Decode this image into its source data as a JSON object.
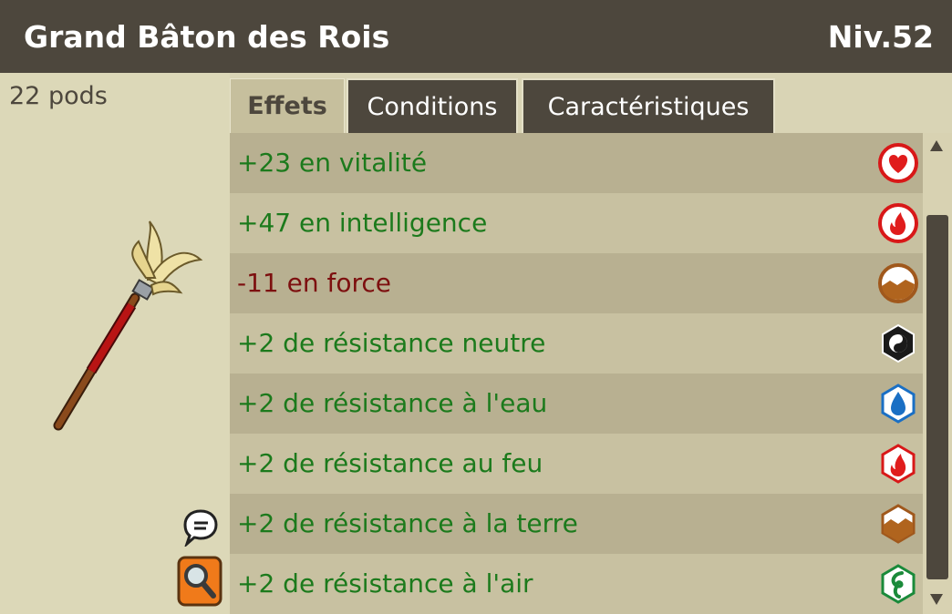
{
  "item": {
    "name": "Grand Bâton des Rois",
    "level": "Niv.52",
    "weight": "22 pods"
  },
  "tabs": [
    {
      "label": "Effets",
      "active": true
    },
    {
      "label": "Conditions",
      "active": false
    },
    {
      "label": "Caractéristiques",
      "active": false
    }
  ],
  "effects": [
    {
      "text": "+23 en vitalité",
      "icon": "vitality-heart-icon"
    },
    {
      "text": "+47 en intelligence",
      "icon": "intelligence-fire-icon"
    },
    {
      "text": "-11 en force",
      "icon": "strength-earth-icon"
    },
    {
      "text": "+2 de résistance neutre",
      "icon": "neutral-resistance-icon"
    },
    {
      "text": "+2 de résistance à l'eau",
      "icon": "water-resistance-icon"
    },
    {
      "text": "+2 de résistance au feu",
      "icon": "fire-resistance-icon"
    },
    {
      "text": "+2 de résistance à la terre",
      "icon": "earth-resistance-icon"
    },
    {
      "text": "+2 de résistance à l'air",
      "icon": "air-resistance-icon"
    }
  ],
  "colors": {
    "header_bg": "#4d473d",
    "positive": "#1c7a1c",
    "negative": "#7d0f0f"
  }
}
